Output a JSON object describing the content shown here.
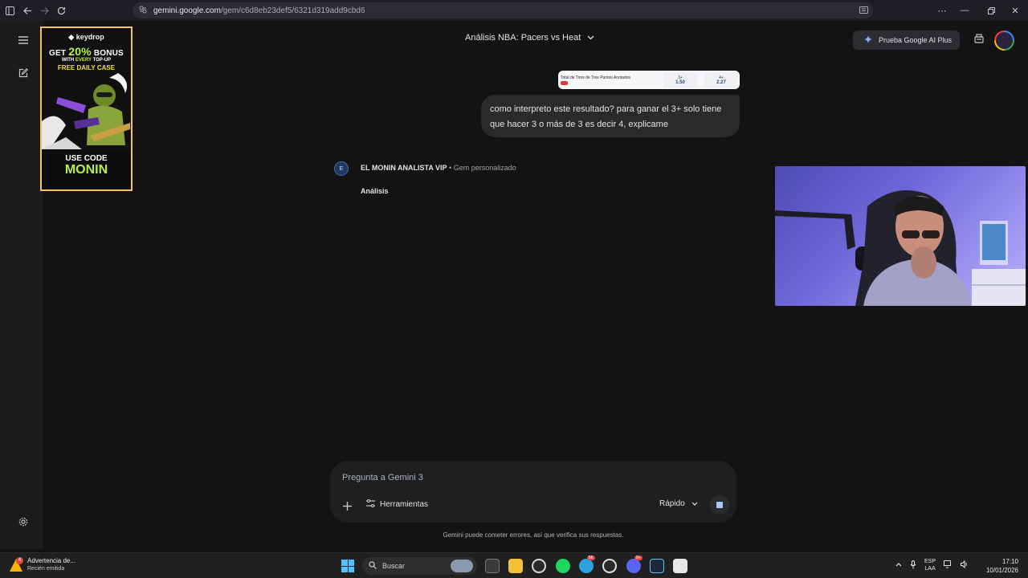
{
  "browser": {
    "url_domain": "gemini.google.com",
    "url_path": "/gem/c6d8eb23def5/6321d319add9cbd6"
  },
  "ad": {
    "brand": "keydrop",
    "bonus_prefix": "GET",
    "bonus_pct": "20%",
    "bonus_suffix": "BONUS",
    "with_every_pre": "WITH",
    "with_every_em": "EVERY",
    "with_every_post": "TOP-UP",
    "free_case": "FREE DAILY CASE",
    "use_code": "USE CODE",
    "code": "MONIN"
  },
  "header": {
    "title": "Análisis NBA: Pacers vs Heat",
    "upgrade_label": "Prueba Google AI Plus"
  },
  "conversation": {
    "attachment": {
      "label": "Total de Tiros de Tres Puntos Anotados",
      "options": [
        {
          "line": "3+",
          "odd": "1.50"
        },
        {
          "line": "4+",
          "odd": "2.27"
        }
      ]
    },
    "user_message": "como interpreto este resultado? para ganar el 3+ solo tiene que hacer 3 o más de 3 es decir 4, explicame",
    "gem_initial": "E",
    "gem_name": "EL MONIN ANALISTA VIP",
    "gem_separator": "•",
    "gem_type": "Gem personalizado",
    "response_heading": "Análisis"
  },
  "composer": {
    "placeholder": "Pregunta a Gemini 3",
    "tools_label": "Herramientas",
    "mode_label": "Rápido",
    "disclaimer": "Gemini puede cometer errores, así que verifica sus respuestas."
  },
  "taskbar": {
    "notif_title": "Advertencia de...",
    "notif_sub": "Recién emitida",
    "search_label": "Buscar",
    "lang_top": "ESP",
    "lang_bottom": "LAA",
    "time": "17:10",
    "date": "10/01/2026",
    "apps": [
      "task-view",
      "file-explorer",
      "obs",
      "spotify",
      "telegram",
      "chrome",
      "discord",
      "steam",
      "app"
    ],
    "badges": {
      "notif": "4",
      "telegram": "56",
      "discord": "9+"
    }
  },
  "colors": {
    "background": "#131314",
    "bubble": "#282a2c",
    "accent_ad": "#b7f046",
    "stop_square": "#a8c7fa"
  }
}
